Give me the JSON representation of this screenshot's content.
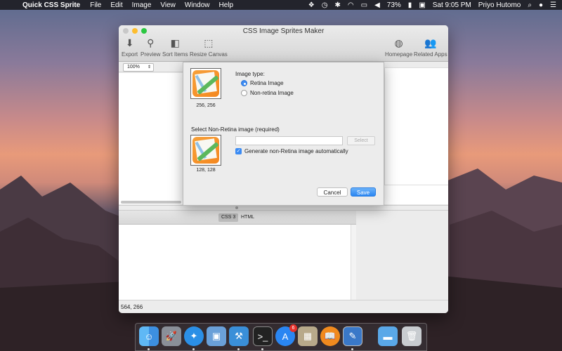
{
  "menubar": {
    "app": "Quick CSS Sprite",
    "items": [
      "File",
      "Edit",
      "Image",
      "View",
      "Window",
      "Help"
    ],
    "battery": "73%",
    "clock": "Sat 9:05 PM",
    "user": "Priyo Hutomo"
  },
  "window": {
    "title": "CSS Image Sprites Maker",
    "toolbar": {
      "export": "Export",
      "preview": "Preview",
      "sort": "Sort Items",
      "resize": "Resize Canvas",
      "homepage": "Homepage",
      "related": "Related Apps"
    },
    "zoom": "100%",
    "tabs": {
      "css": "CSS 3",
      "html": "HTML"
    },
    "status": "564, 266"
  },
  "dialog": {
    "retina_size": "256, 256",
    "image_type_label": "Image type:",
    "retina_option": "Retina Image",
    "nonretina_option": "Non-retina Image",
    "nonretina_section": "Select Non-Retina image (required)",
    "nonretina_size": "128, 128",
    "select_button": "Select",
    "generate_label": "Generate non-Retina image automatically",
    "cancel": "Cancel",
    "save": "Save",
    "retina_selected": true,
    "generate_checked": true
  },
  "dock": {
    "badge_appstore": "6"
  }
}
